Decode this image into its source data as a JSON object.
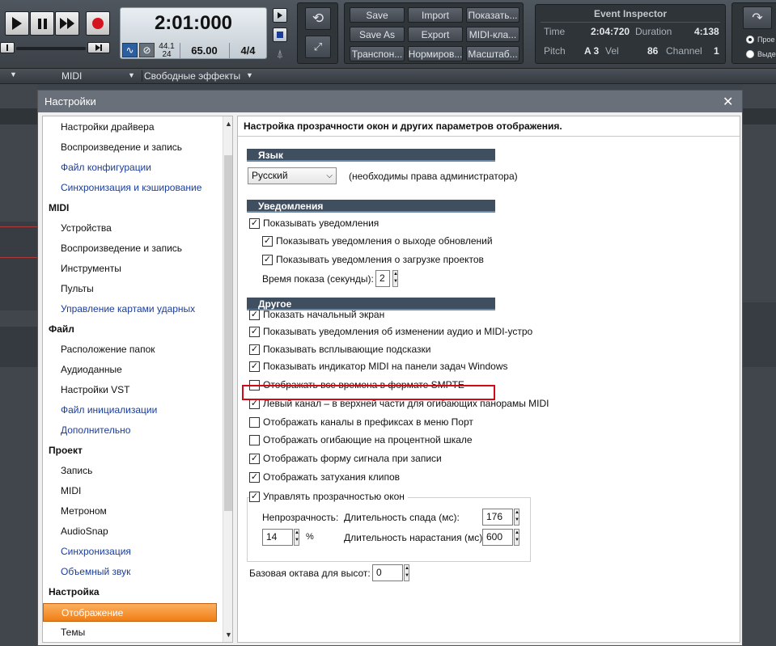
{
  "toolbar": {
    "clock_time": "2:01:000",
    "sample_rate": "44.1",
    "bit_depth": "24",
    "tempo": "65.00",
    "meter": "4/4",
    "buttons": {
      "save": "Save",
      "import": "Import",
      "show": "Показать...",
      "save_as": "Save As",
      "export": "Export",
      "midi_keys": "MIDI-кла...",
      "transpose": "Транспон...",
      "normalize": "Нормиров...",
      "scale": "Масштаб..."
    },
    "event_inspector": {
      "title": "Event Inspector",
      "time_label": "Time",
      "time_value": "2:04:720",
      "duration_label": "Duration",
      "duration_value": "4:138",
      "pitch_label": "Pitch",
      "pitch_value": "A 3",
      "vel_label": "Vel",
      "vel_value": "86",
      "channel_label": "Channel",
      "channel_value": "1"
    },
    "radio1": "Прое",
    "radio2": "Выде"
  },
  "bar2": {
    "midi": "MIDI",
    "fx": "Свободные эффекты"
  },
  "dialog": {
    "title": "Настройки",
    "close": "✕"
  },
  "nav": [
    {
      "type": "item",
      "label": "Настройки драйвера",
      "link": false
    },
    {
      "type": "item",
      "label": "Воспроизведение и запись",
      "link": false
    },
    {
      "type": "item",
      "label": "Файл конфигурации",
      "link": true
    },
    {
      "type": "item",
      "label": "Синхронизация и кэширование",
      "link": true
    },
    {
      "type": "cat",
      "label": "MIDI"
    },
    {
      "type": "item",
      "label": "Устройства",
      "link": false
    },
    {
      "type": "item",
      "label": "Воспроизведение и запись",
      "link": false
    },
    {
      "type": "item",
      "label": "Инструменты",
      "link": false
    },
    {
      "type": "item",
      "label": "Пульты",
      "link": false
    },
    {
      "type": "item",
      "label": "Управление картами ударных",
      "link": true
    },
    {
      "type": "cat",
      "label": "Файл"
    },
    {
      "type": "item",
      "label": "Расположение папок",
      "link": false
    },
    {
      "type": "item",
      "label": "Аудиоданные",
      "link": false
    },
    {
      "type": "item",
      "label": "Настройки VST",
      "link": false
    },
    {
      "type": "item",
      "label": "Файл инициализации",
      "link": true
    },
    {
      "type": "item",
      "label": "Дополнительно",
      "link": true
    },
    {
      "type": "cat",
      "label": "Проект"
    },
    {
      "type": "item",
      "label": "Запись",
      "link": false
    },
    {
      "type": "item",
      "label": "MIDI",
      "link": false
    },
    {
      "type": "item",
      "label": "Метроном",
      "link": false
    },
    {
      "type": "item",
      "label": "AudioSnap",
      "link": false
    },
    {
      "type": "item",
      "label": "Синхронизация",
      "link": true
    },
    {
      "type": "item",
      "label": "Объемный звук",
      "link": true
    },
    {
      "type": "cat",
      "label": "Настройка"
    },
    {
      "type": "item",
      "label": "Отображение",
      "link": false,
      "selected": true
    },
    {
      "type": "item",
      "label": "Темы",
      "link": false
    }
  ],
  "content": {
    "header": "Настройка прозрачности окон и других параметров отображения.",
    "lang_section": "Язык",
    "lang_value": "Русский",
    "lang_note": "(необходимы права администратора)",
    "notif_section": "Уведомления",
    "notif_show": "Показывать уведомления",
    "notif_updates": "Показывать уведомления о выходе обновлений",
    "notif_projects": "Показывать уведомления о загрузке проектов",
    "show_time_label": "Время показа (секунды):",
    "show_time_value": "2",
    "other_section": "Другое",
    "opts": [
      {
        "label": "Показать начальный экран",
        "checked": true
      },
      {
        "label": "Показывать уведомления об изменении аудио и MIDI-устро",
        "checked": true
      },
      {
        "label": "Показывать всплывающие подсказки",
        "checked": true
      },
      {
        "label": "Показывать индикатор MIDI на панели задач Windows",
        "checked": true
      },
      {
        "label": "Отображать все времена в формате SMPTE",
        "checked": false,
        "highlight": true
      },
      {
        "label": "Левый канал – в верхней части для огибающих панорамы MIDI",
        "checked": true
      },
      {
        "label": "Отображать каналы в префиксах в меню Порт",
        "checked": false
      },
      {
        "label": "Отображать огибающие на процентной шкале",
        "checked": false
      },
      {
        "label": "Отображать форму сигнала при записи",
        "checked": true
      },
      {
        "label": "Отображать затухания клипов",
        "checked": true
      }
    ],
    "transparency_label": "Управлять прозрачностью окон",
    "opacity_label": "Непрозрачность:",
    "opacity_value": "14",
    "percent": "%",
    "fade_out_label": "Длительность спада (мс):",
    "fade_out_value": "176",
    "fade_in_label": "Длительность нарастания (мс):",
    "fade_in_value": "600",
    "base_octave_label": "Базовая октава для высот:",
    "base_octave_value": "0"
  }
}
